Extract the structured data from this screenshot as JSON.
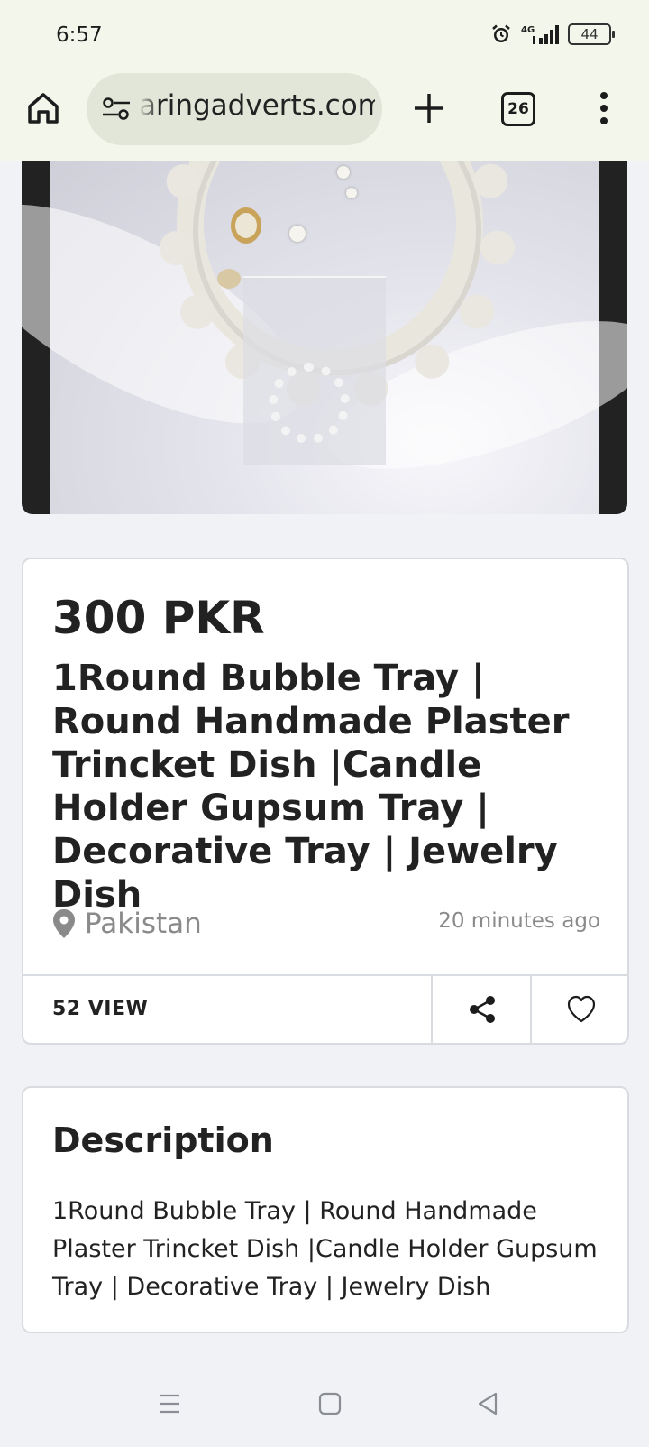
{
  "status_bar": {
    "time": "6:57",
    "network": "4G",
    "battery": "44"
  },
  "browser": {
    "url": "aringadverts.com",
    "tab_count": "26"
  },
  "listing": {
    "price": "300 PKR",
    "title": "1Round Bubble Tray | Round Handmade Plaster Trincket Dish |Candle Holder Gupsum Tray | Decorative Tray | Jewelry Dish",
    "location": "Pakistan",
    "posted": "20 minutes ago",
    "views": "52 VIEW"
  },
  "description": {
    "heading": "Description",
    "body": "1Round Bubble Tray | Round Handmade Plaster Trincket Dish |Candle Holder Gupsum Tray | Decorative Tray | Jewelry Dish"
  },
  "icons": {
    "home": "home-icon",
    "site_info": "tune-icon",
    "new_tab": "plus-icon",
    "menu": "more-vertical-icon",
    "location": "map-pin-icon",
    "share": "share-icon",
    "favorite": "heart-icon"
  }
}
